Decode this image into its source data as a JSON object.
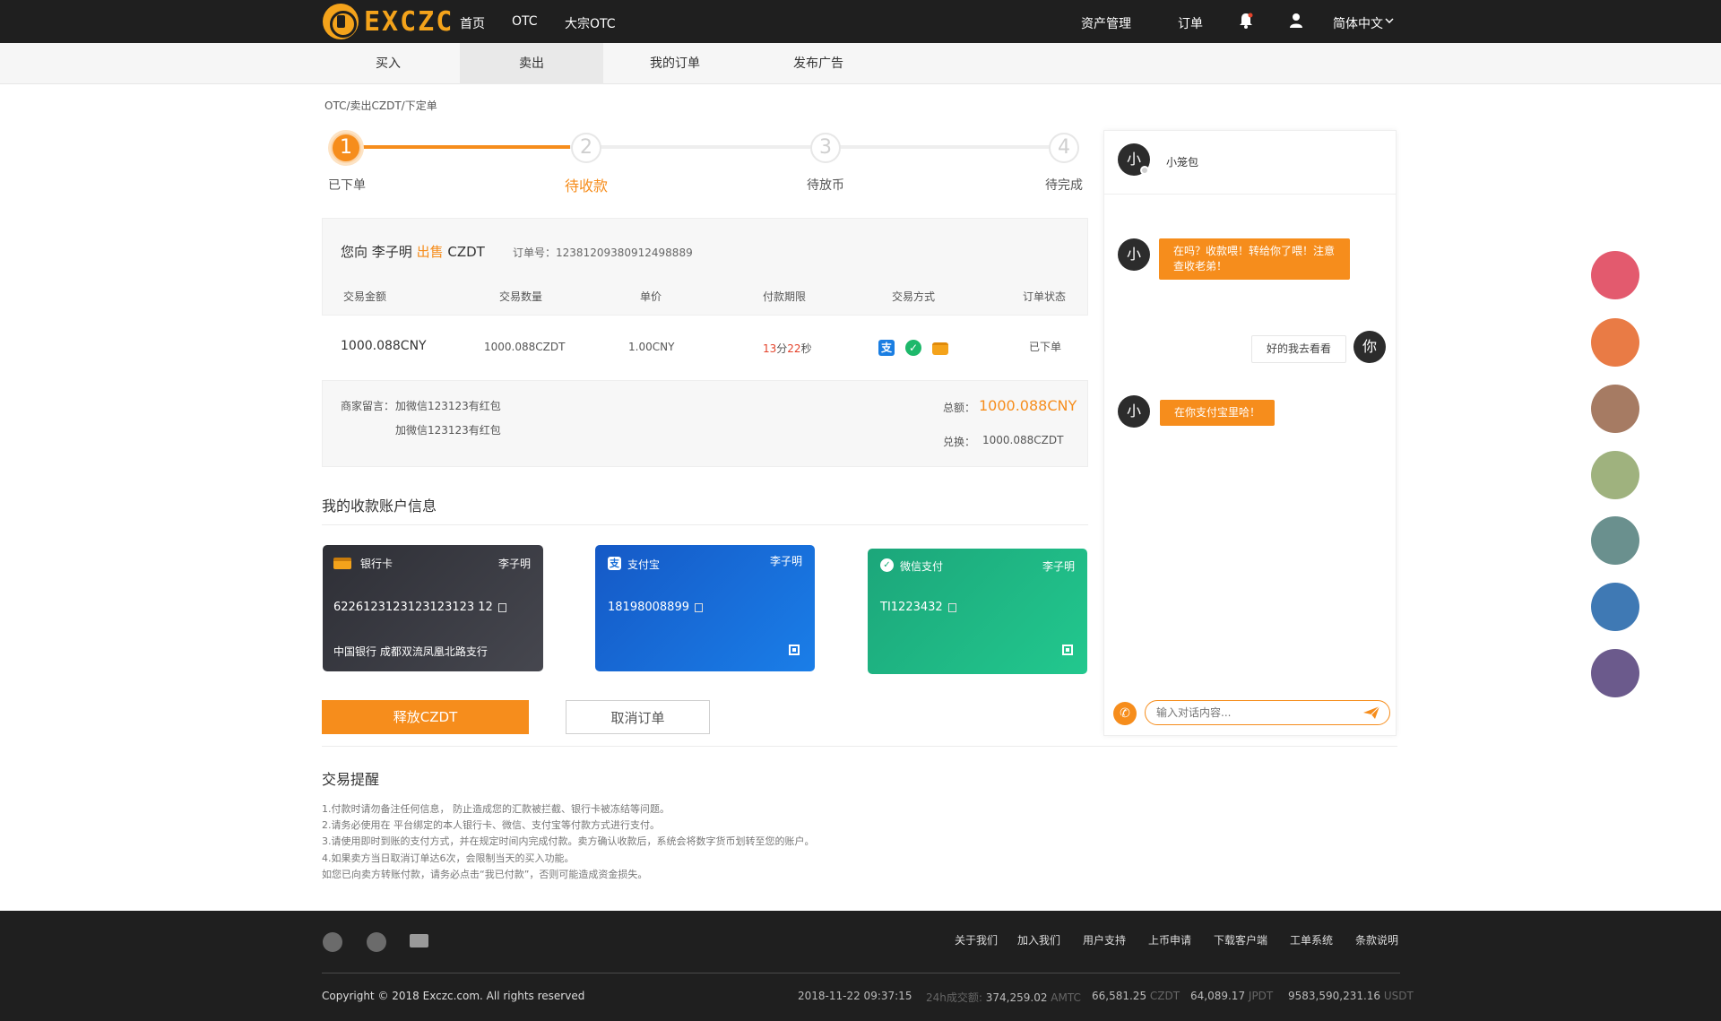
{
  "header": {
    "logo_text": "EXCZC",
    "nav": [
      "首页",
      "OTC",
      "大宗OTC"
    ],
    "right": {
      "assets": "资产管理",
      "orders": "订单",
      "language": "简体中文"
    }
  },
  "subnav": {
    "tabs": [
      "买入",
      "卖出",
      "我的订单",
      "发布广告"
    ],
    "active": "卖出"
  },
  "breadcrumb": "OTC/卖出CZDT/下定单",
  "steps": [
    {
      "num": "1",
      "label": "已下单"
    },
    {
      "num": "2",
      "label": "待收款"
    },
    {
      "num": "3",
      "label": "待放币"
    },
    {
      "num": "4",
      "label": "待完成"
    }
  ],
  "order": {
    "prefix": "您向 李子明",
    "action": "出售",
    "coin": "CZDT",
    "no_label": "订单号：",
    "no": "12381209380912498889",
    "columns": [
      "交易金额",
      "交易数量",
      "单价",
      "付款期限",
      "交易方式",
      "订单状态"
    ],
    "amount": "1000.088CNY",
    "quantity": "1000.088CZDT",
    "price": "1.00CNY",
    "deadline_min": "13",
    "min_unit": "分",
    "deadline_sec": "22",
    "sec_unit": "秒",
    "status": "已下单",
    "note_label": "商家留言：",
    "note_1": "加微信123123有红包",
    "note_2": "加微信123123有红包",
    "total_label": "总额：",
    "total": "1000.088CNY",
    "exchange_label": "兑换：",
    "exchange": "1000.088CZDT"
  },
  "accounts": {
    "title": "我的收款账户信息",
    "bank": {
      "type": "银行卡",
      "name": "李子明",
      "number": "6226123123123123123 12",
      "branch": "中国银行 成都双流凤凰北路支行"
    },
    "alipay": {
      "type": "支付宝",
      "name": "李子明",
      "number": "18198008899"
    },
    "wechat": {
      "type": "微信支付",
      "name": "李子明",
      "number": "TI1223432"
    }
  },
  "buttons": {
    "release": "释放CZDT",
    "cancel": "取消订单"
  },
  "tips": {
    "title": "交易提醒",
    "lines": [
      "1.付款时请勿备注任何信息， 防止造成您的汇款被拦截、银行卡被冻结等问题。",
      "2.请务必使用在 平台绑定的本人银行卡、微信、支付宝等付款方式进行支付。",
      "3.请使用即时到账的支付方式，并在规定时间内完成付款。卖方确认收款后，系统会将数字货币划转至您的账户。",
      "4.如果卖方当日取消订单达6次，会限制当天的买入功能。",
      "如您已向卖方转账付款，请务必点击“我已付款”，否则可能造成资金损失。"
    ]
  },
  "chat": {
    "contact_avatar": "小",
    "contact_name": "小笼包",
    "my_avatar": "你",
    "messages": [
      {
        "from": "them",
        "text": "在吗？收款喂！转给你了喂！注意查收老弟！"
      },
      {
        "from": "me",
        "text": "好的我去看看"
      },
      {
        "from": "them",
        "text": "在你支付宝里哈！"
      }
    ],
    "placeholder": "输入对话内容..."
  },
  "theme_colors": [
    "#e35a6e",
    "#e97b45",
    "#a67b63",
    "#9fb27e",
    "#6a908e",
    "#3f79b4",
    "#6b5a8c"
  ],
  "footer": {
    "links": [
      "关于我们",
      "加入我们",
      "用户支持",
      "上币申请",
      "下载客户端",
      "工单系统",
      "条款说明"
    ],
    "copyright": "Copyright © 2018 Exczc.com. All rights reserved",
    "datetime": "2018-11-22  09:37:15",
    "vol_label": "24h成交额:",
    "stats": [
      {
        "value": "374,259.02",
        "unit": "AMTC"
      },
      {
        "value": "66,581.25",
        "unit": "CZDT"
      },
      {
        "value": "64,089.17",
        "unit": "JPDT"
      },
      {
        "value": "9583,590,231.16",
        "unit": "USDT"
      }
    ]
  }
}
